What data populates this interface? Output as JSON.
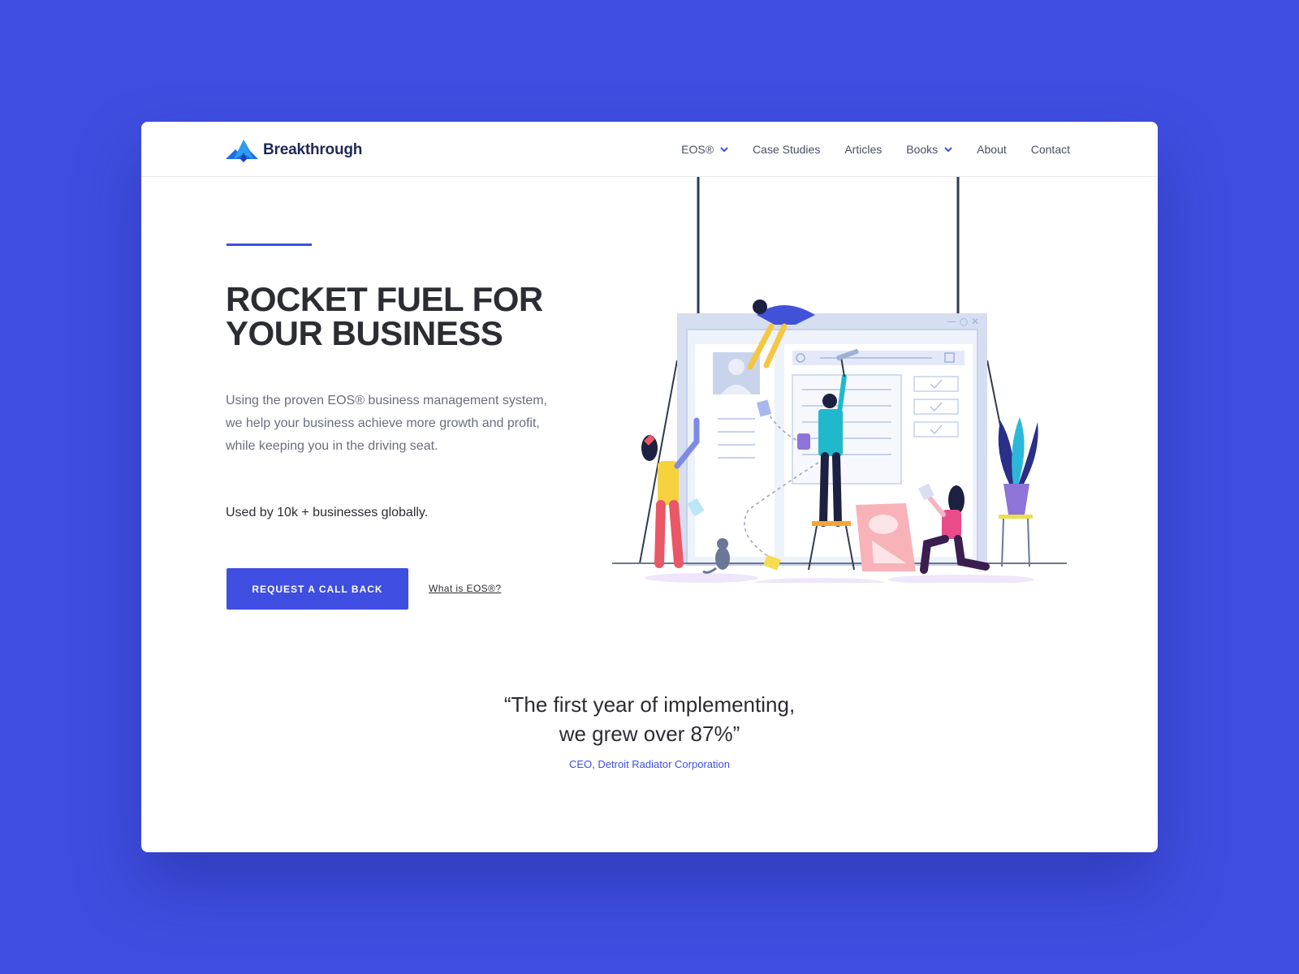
{
  "brand": {
    "name": "Breakthrough",
    "logo_icon": "mountain-peaks-icon",
    "accent_color": "#3f4ee0",
    "background_color": "#3f4ee0"
  },
  "nav": {
    "items": [
      {
        "label": "EOS®",
        "dropdown": true
      },
      {
        "label": "Case Studies",
        "dropdown": false
      },
      {
        "label": "Articles",
        "dropdown": false
      },
      {
        "label": "Books",
        "dropdown": true
      },
      {
        "label": "About",
        "dropdown": false
      },
      {
        "label": "Contact",
        "dropdown": false
      }
    ]
  },
  "hero": {
    "headline_line1": "ROCKET FUEL FOR",
    "headline_line2": "YOUR BUSINESS",
    "intro": "Using the proven EOS® business management system, we help your business achieve more growth and profit, while keeping you in the driving seat.",
    "usage": "Used by 10k + businesses globally.",
    "cta_label": "REQUEST A CALL BACK",
    "secondary_link": "What is EOS®?"
  },
  "testimonial": {
    "quote_line1": "“The first year of implementing,",
    "quote_line2": "we grew over 87%”",
    "attribution": "CEO, Detroit Radiator Corporation"
  }
}
